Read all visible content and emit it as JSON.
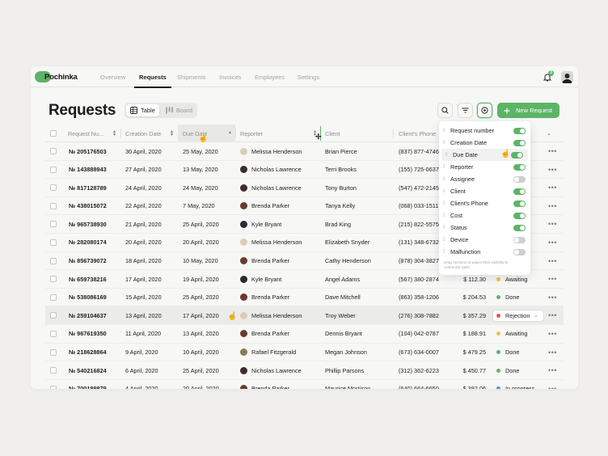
{
  "app": {
    "logo": "Pochinka"
  },
  "nav": {
    "tabs": [
      {
        "label": "Overview",
        "active": false
      },
      {
        "label": "Requests",
        "active": true
      },
      {
        "label": "Shipments",
        "active": false
      },
      {
        "label": "Invoices",
        "active": false
      },
      {
        "label": "Employees",
        "active": false
      },
      {
        "label": "Settings",
        "active": false
      }
    ],
    "notification_count": "3"
  },
  "header": {
    "title": "Requests",
    "views": [
      {
        "label": "Table",
        "icon": "table-icon",
        "active": true
      },
      {
        "label": "Board",
        "icon": "board-icon",
        "active": false
      }
    ],
    "new_button": "New Request"
  },
  "table": {
    "columns": [
      {
        "label": "Request Nu...",
        "sort": "both"
      },
      {
        "label": "Creation Date",
        "sort": "both"
      },
      {
        "label": "Due Date",
        "sort": "up",
        "highlighted": true
      },
      {
        "label": "Reporter",
        "sort": "both"
      },
      {
        "label": "Client",
        "sort": "none"
      },
      {
        "label": "Client's Phone",
        "sort": "none"
      }
    ],
    "rows": [
      {
        "number": "№ 205176503",
        "created": "30 April, 2020",
        "due": "25 May, 2020",
        "reporter": "Melissa Henderson",
        "reporter_color": "#d9cdb6",
        "client": "Brian Pierce",
        "phone": "(837) 877-4746",
        "cost": "",
        "status": "",
        "status_color": ""
      },
      {
        "number": "№ 143888943",
        "created": "27 April, 2020",
        "due": "13 May, 2020",
        "reporter": "Nicholas Lawrence",
        "reporter_color": "#3b2e2a",
        "client": "Terri Brooks",
        "phone": "(155) 725-0637",
        "cost": "",
        "status": "",
        "status_color": ""
      },
      {
        "number": "№ 817128789",
        "created": "24 April, 2020",
        "due": "24 May, 2020",
        "reporter": "Nicholas Lawrence",
        "reporter_color": "#3b2e2a",
        "client": "Tony Burton",
        "phone": "(547) 472-2145",
        "cost": "",
        "status": "",
        "status_color": ""
      },
      {
        "number": "№ 438015072",
        "created": "22 April, 2020",
        "due": "7 May, 2020",
        "reporter": "Brenda Parker",
        "reporter_color": "#6b3a2e",
        "client": "Tanya Kelly",
        "phone": "(068) 033-1511",
        "cost": "",
        "status": "",
        "status_color": ""
      },
      {
        "number": "№ 965738930",
        "created": "21 April, 2020",
        "due": "25 April, 2020",
        "reporter": "Kyle Bryant",
        "reporter_color": "#2d2a33",
        "client": "Brad King",
        "phone": "(215) 822-5575",
        "cost": "",
        "status": "",
        "status_color": ""
      },
      {
        "number": "№ 282080174",
        "created": "20 April, 2020",
        "due": "20 April, 2020",
        "reporter": "Melissa Henderson",
        "reporter_color": "#d9cdb6",
        "client": "Elizabeth Snyder",
        "phone": "(131) 348-6732",
        "cost": "",
        "status": "",
        "status_color": ""
      },
      {
        "number": "№ 856739072",
        "created": "18 April, 2020",
        "due": "10 May, 2020",
        "reporter": "Brenda Parker",
        "reporter_color": "#6b3a2e",
        "client": "Cathy Henderson",
        "phone": "(878) 304-3827",
        "cost": "",
        "status": "",
        "status_color": ""
      },
      {
        "number": "№ 659738216",
        "created": "17 April, 2020",
        "due": "19 April, 2020",
        "reporter": "Kyle Bryant",
        "reporter_color": "#2d2a33",
        "client": "Angel Adams",
        "phone": "(567) 380-2874",
        "cost": "$ 112.30",
        "status": "Awaiting",
        "status_color": "#e3c54c"
      },
      {
        "number": "№ 538086169",
        "created": "15 April, 2020",
        "due": "25 April, 2020",
        "reporter": "Brenda Parker",
        "reporter_color": "#6b3a2e",
        "client": "Dave Mitchell",
        "phone": "(863) 358-1206",
        "cost": "$ 204.53",
        "status": "Done",
        "status_color": "#5cb466"
      },
      {
        "number": "№ 259104637",
        "created": "13 April, 2020",
        "due": "17 April, 2020",
        "reporter": "Melissa Henderson",
        "reporter_color": "#d9cdb6",
        "client": "Troy Weber",
        "phone": "(276) 308-7882",
        "cost": "$ 357.29",
        "status": "Rejection",
        "status_color": "#e05a4e",
        "highlighted": true
      },
      {
        "number": "№ 967619350",
        "created": "11 April, 2020",
        "due": "13 April, 2020",
        "reporter": "Brenda Parker",
        "reporter_color": "#6b3a2e",
        "client": "Dennis Bryant",
        "phone": "(104) 042-0787",
        "cost": "$ 188.91",
        "status": "Awaiting",
        "status_color": "#e3c54c"
      },
      {
        "number": "№ 218628864",
        "created": "9 April, 2020",
        "due": "10 April, 2020",
        "reporter": "Rafael Fitzgerald",
        "reporter_color": "#8a7a5a",
        "client": "Megan Johnson",
        "phone": "(673) 634-0007",
        "cost": "$ 479.25",
        "status": "Done",
        "status_color": "#5cb466"
      },
      {
        "number": "№ 540216824",
        "created": "6 April, 2020",
        "due": "25 April, 2020",
        "reporter": "Nicholas Lawrence",
        "reporter_color": "#3b2e2a",
        "client": "Phillip Parsons",
        "phone": "(312) 362-6223",
        "cost": "$ 450.77",
        "status": "Done",
        "status_color": "#5cb466"
      },
      {
        "number": "№ 700189879",
        "created": "4 April, 2020",
        "due": "20 April, 2020",
        "reporter": "Brenda Parker",
        "reporter_color": "#6b3a2e",
        "client": "Maurice Morrison",
        "phone": "(640) 664-6650",
        "cost": "$ 392.06",
        "status": "In progress",
        "status_color": "#5b8fd6"
      }
    ]
  },
  "column_panel": {
    "items": [
      {
        "label": "Request number",
        "on": true
      },
      {
        "label": "Creation Date",
        "on": true
      },
      {
        "label": "Due Date",
        "on": true,
        "highlighted": true
      },
      {
        "label": "Reporter",
        "on": true
      },
      {
        "label": "Assignee",
        "on": false
      },
      {
        "label": "Client",
        "on": true
      },
      {
        "label": "Client's Phone",
        "on": true
      },
      {
        "label": "Cost",
        "on": true
      },
      {
        "label": "Status",
        "on": true
      },
      {
        "label": "Device",
        "on": false
      },
      {
        "label": "Malfunction",
        "on": false
      }
    ],
    "hint": "Drag sections or adjust their visibility to customize table."
  },
  "colors": {
    "accent": "#5cb466",
    "background": "#f7f7f6"
  }
}
